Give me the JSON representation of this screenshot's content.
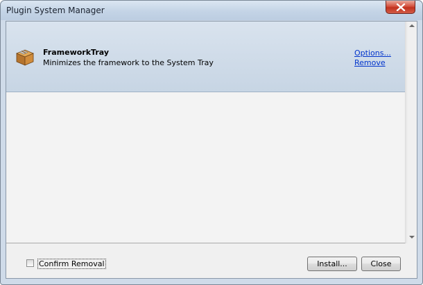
{
  "window": {
    "title": "Plugin System Manager"
  },
  "plugins": [
    {
      "name": "FrameworkTray",
      "description": "Minimizes the framework to the System Tray",
      "options_label": "Options...",
      "remove_label": "Remove",
      "icon": "package-box-icon"
    }
  ],
  "footer": {
    "confirm_removal_label": "Confirm Removal",
    "confirm_removal_checked": false,
    "install_label": "Install...",
    "close_label": "Close"
  },
  "colors": {
    "item_selected_bg": "#c7d5e4",
    "link": "#0033cc",
    "close_button": "#c1321f"
  }
}
